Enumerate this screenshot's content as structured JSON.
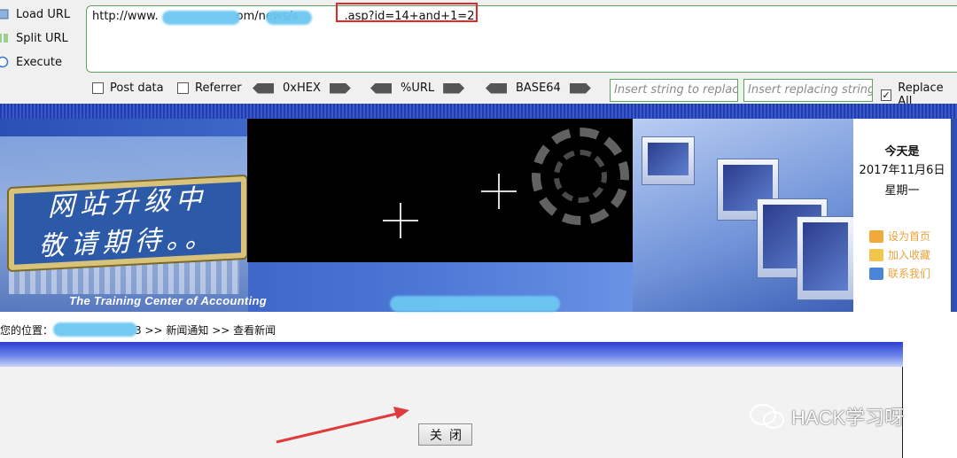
{
  "hackbar": {
    "load_url": "Load URL",
    "split_url": "Split URL",
    "execute": "Execute",
    "url_prefix": "http://www.",
    "url_mid": "om/news/s",
    "url_suffix": ".asp",
    "url_query": "?id=14+and+1=2",
    "options": {
      "post_data": "Post data",
      "referrer": "Referrer",
      "hex": "0xHEX",
      "url_enc": "%URL",
      "base64": "BASE64",
      "insert_replace_placeholder": "Insert string to replace",
      "insert_replacing_placeholder": "Insert replacing string",
      "replace_all": "Replace All"
    },
    "colors": {
      "highlight_box": "#e02a2a",
      "input_border": "#5aa55a",
      "redaction": "#6cc7f2"
    }
  },
  "banner": {
    "title_line1": "网站升级中",
    "title_line2": "敬请期待。。",
    "subtitle": "The Training Center of Accounting",
    "today_label": "今天是",
    "date": "2017年11月6日",
    "weekday": "星期一",
    "links": [
      "设为首页",
      "加入收藏",
      "联系我们"
    ]
  },
  "breadcrumb": {
    "prefix": "您的位置：",
    "suffix": "3 >> 新闻通知 >> 查看新闻"
  },
  "content": {
    "close_button": "关闭"
  },
  "watermark": {
    "text": "HACK学习呀"
  }
}
